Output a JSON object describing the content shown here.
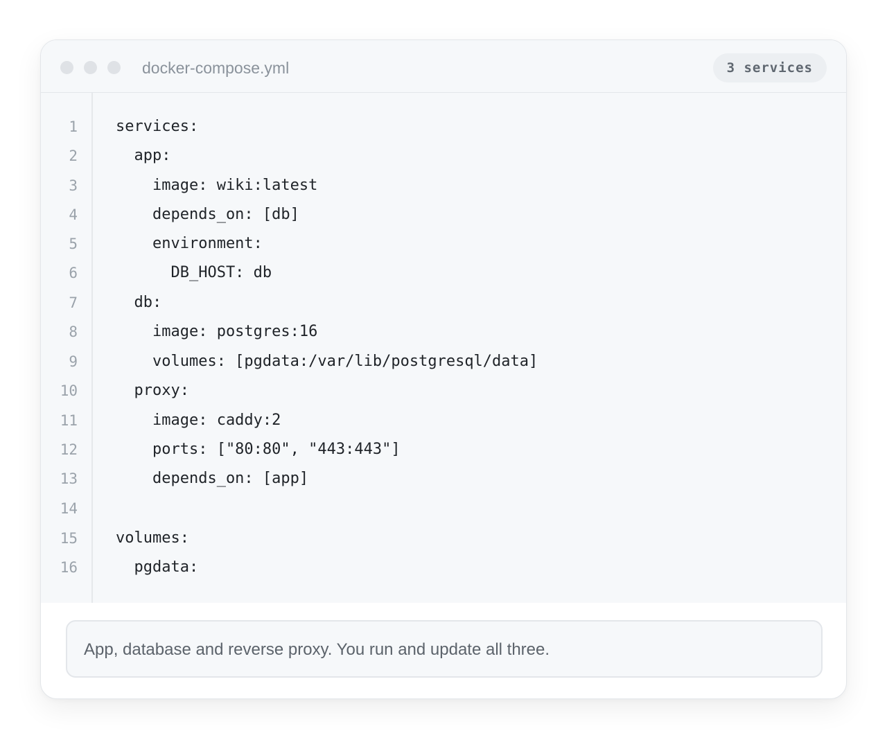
{
  "window": {
    "filename": "docker-compose.yml",
    "badge": "3 services"
  },
  "code": {
    "line_numbers": [
      "1",
      "2",
      "3",
      "4",
      "5",
      "6",
      "7",
      "8",
      "9",
      "10",
      "11",
      "12",
      "13",
      "14",
      "15",
      "16"
    ],
    "lines": [
      "services:",
      "  app:",
      "    image: wiki:latest",
      "    depends_on: [db]",
      "    environment:",
      "      DB_HOST: db",
      "  db:",
      "    image: postgres:16",
      "    volumes: [pgdata:/var/lib/postgresql/data]",
      "  proxy:",
      "    image: caddy:2",
      "    ports: [\"80:80\", \"443:443\"]",
      "    depends_on: [app]",
      "",
      "volumes:",
      "  pgdata:"
    ]
  },
  "footer": {
    "note": "App, database and reverse proxy. You run and update all three."
  },
  "colors": {
    "panel_bg": "#f6f8fa",
    "border": "#e3e6ea",
    "code_text": "#1f2328",
    "muted_text": "#8a929b"
  }
}
